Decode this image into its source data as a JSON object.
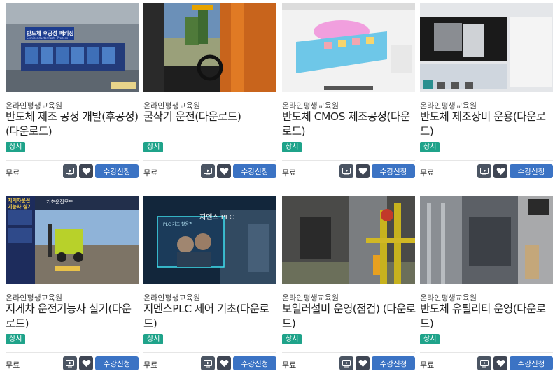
{
  "courses": [
    {
      "provider": "온라인평생교육원",
      "title": "반도체 제조 공정 개발(후공정)(다운로드)",
      "badge": "상시",
      "price": "무료",
      "enroll_label": "수강신청",
      "thumb_text": "반도체 후공정 패키징",
      "thumb_subtext": "Semiconductor Post - Process"
    },
    {
      "provider": "온라인평생교육원",
      "title": "굴삭기 운전(다운로드)",
      "badge": "상시",
      "price": "무료",
      "enroll_label": "수강신청",
      "thumb_text": "",
      "thumb_subtext": ""
    },
    {
      "provider": "온라인평생교육원",
      "title": "반도체 CMOS 제조공정(다운로드)",
      "badge": "상시",
      "price": "무료",
      "enroll_label": "수강신청",
      "thumb_text": "",
      "thumb_subtext": ""
    },
    {
      "provider": "온라인평생교육원",
      "title": "반도체 제조장비 운용(다운로드)",
      "badge": "상시",
      "price": "무료",
      "enroll_label": "수강신청",
      "thumb_text": "",
      "thumb_subtext": ""
    },
    {
      "provider": "온라인평생교육원",
      "title": "지게차 운전기능사 실기(다운로드)",
      "badge": "상시",
      "price": "무료",
      "enroll_label": "수강신청",
      "thumb_text": "지게차운전 기능사 실기",
      "thumb_subtext": "기초운전모드"
    },
    {
      "provider": "온라인평생교육원",
      "title": "지멘스PLC 제어 기초(다운로드)",
      "badge": "상시",
      "price": "무료",
      "enroll_label": "수강신청",
      "thumb_text": "지멘스 PLC",
      "thumb_subtext": "PLC 기초 활용편"
    },
    {
      "provider": "온라인평생교육원",
      "title": "보일러설비 운영(점검) (다운로드)",
      "badge": "상시",
      "price": "무료",
      "enroll_label": "수강신청",
      "thumb_text": "",
      "thumb_subtext": ""
    },
    {
      "provider": "온라인평생교육원",
      "title": "반도체 유틸리티 운영(다운로드)",
      "badge": "상시",
      "price": "무료",
      "enroll_label": "수강신청",
      "thumb_text": "",
      "thumb_subtext": ""
    }
  ],
  "icons": {
    "preview": "play-screen-icon",
    "wishlist": "heart-icon"
  },
  "colors": {
    "badge": "#1fa38a",
    "enroll_button": "#3b73c4",
    "icon_button": "#4b5563"
  }
}
